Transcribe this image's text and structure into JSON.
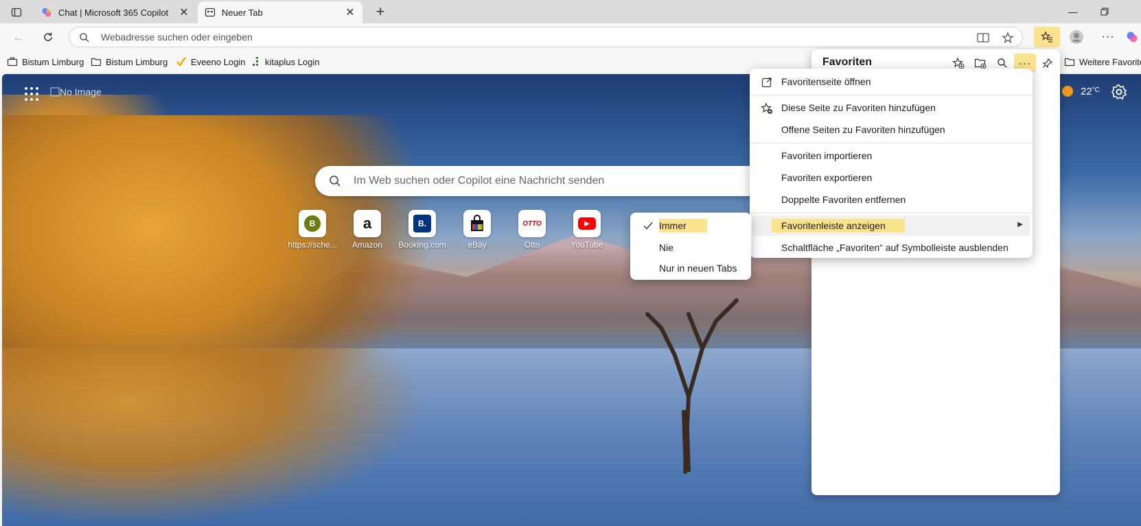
{
  "tabs": [
    {
      "title": "Chat | Microsoft 365 Copilot",
      "favicon": "copilot-icon"
    },
    {
      "title": "Neuer Tab",
      "favicon": "newtab-icon"
    }
  ],
  "toolbar": {
    "address_placeholder": "Webadresse suchen oder eingeben"
  },
  "bookmarks": [
    {
      "label": "Bistum Limburg",
      "icon": "briefcase-icon"
    },
    {
      "label": "Bistum Limburg",
      "icon": "folder-icon"
    },
    {
      "label": "Eveeno Login",
      "icon": "checkmark-icon"
    },
    {
      "label": "kitaplus Login",
      "icon": "dots-icon"
    },
    {
      "label": "Weitere Favoriten",
      "icon": "folder-icon"
    }
  ],
  "ntp": {
    "logo_alt": "No Image",
    "weather_temp": "22",
    "weather_unit": "°C",
    "search_placeholder": "Im Web suchen oder Copilot eine Nachricht senden",
    "tiles": [
      {
        "label": "https://sche...",
        "letter": "B",
        "color": "#6b7d12"
      },
      {
        "label": "Amazon",
        "letter": "a",
        "color": "#111111"
      },
      {
        "label": "Booking.com",
        "letter": "B.",
        "color": "#003580"
      },
      {
        "label": "eBay",
        "letter": "🛍",
        "color": "#e53238"
      },
      {
        "label": "Otto",
        "letter": "OTTO",
        "color": "#e3000f"
      },
      {
        "label": "YouTube",
        "letter": "▶",
        "color": "#ff0000"
      }
    ]
  },
  "favorites_panel": {
    "title": "Favoriten"
  },
  "menu": {
    "items": [
      {
        "label": "Favoritenseite öffnen",
        "icon": "external-link-icon"
      },
      {
        "label": "Diese Seite zu Favoriten hinzufügen",
        "icon": "star-add-icon"
      },
      {
        "label": "Offene Seiten zu Favoriten hinzufügen",
        "icon": ""
      },
      {
        "label": "Favoriten importieren",
        "icon": ""
      },
      {
        "label": "Favoriten exportieren",
        "icon": ""
      },
      {
        "label": "Doppelte Favoriten entfernen",
        "icon": ""
      },
      {
        "label": "Favoritenleiste anzeigen",
        "icon": ""
      },
      {
        "label": "Schaltfläche „Favoriten“ auf Symbolleiste ausblenden",
        "icon": ""
      }
    ]
  },
  "submenu": {
    "items": [
      {
        "label": "Immer",
        "checked": true
      },
      {
        "label": "Nie",
        "checked": false
      },
      {
        "label": "Nur in neuen Tabs",
        "checked": false
      }
    ]
  },
  "colors": {
    "highlight": "#fbe38e",
    "accent": "#0f6cbd"
  }
}
